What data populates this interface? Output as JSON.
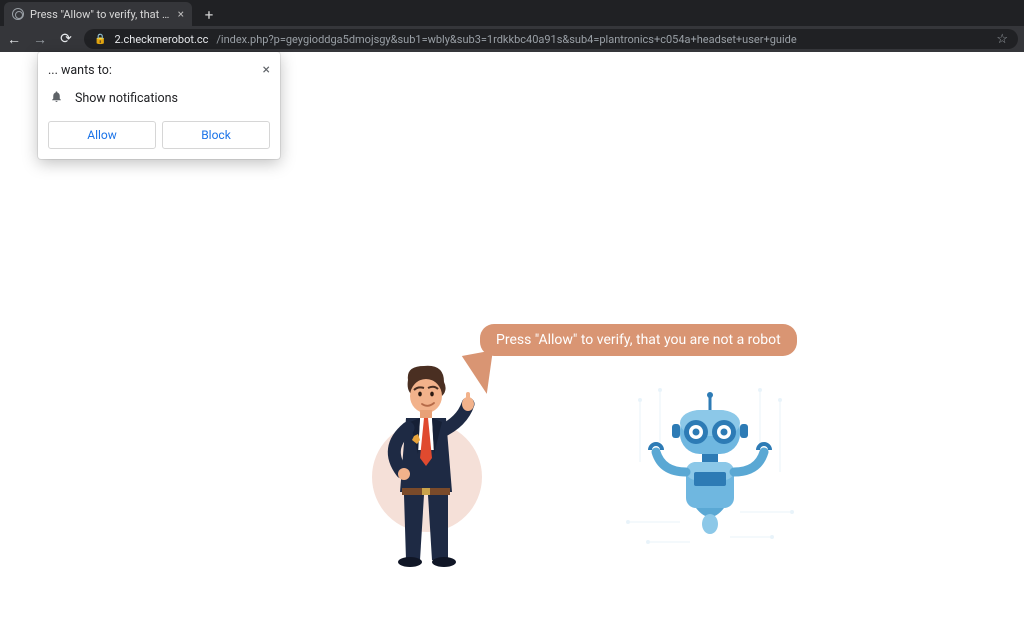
{
  "browser": {
    "tab_title": "Press \"Allow\" to verify, that yo",
    "url_domain": "2.checkmerobot.cc",
    "url_path": "/index.php?p=geygioddga5dmojsgy&sub1=wbly&sub3=1rdkkbc40a91s&sub4=plantronics+c054a+headset+user+guide"
  },
  "permission_prompt": {
    "origin_text": "... wants to:",
    "permission_label": "Show notifications",
    "allow_label": "Allow",
    "block_label": "Block"
  },
  "page": {
    "speech_bubble": "Press \"Allow\" to verify, that you are not a robot"
  },
  "colors": {
    "bubble": "#d99573",
    "robot_primary": "#4aa0d8",
    "robot_dark": "#2d7bb5",
    "suit": "#1e2a44",
    "tie": "#e04a2f"
  }
}
